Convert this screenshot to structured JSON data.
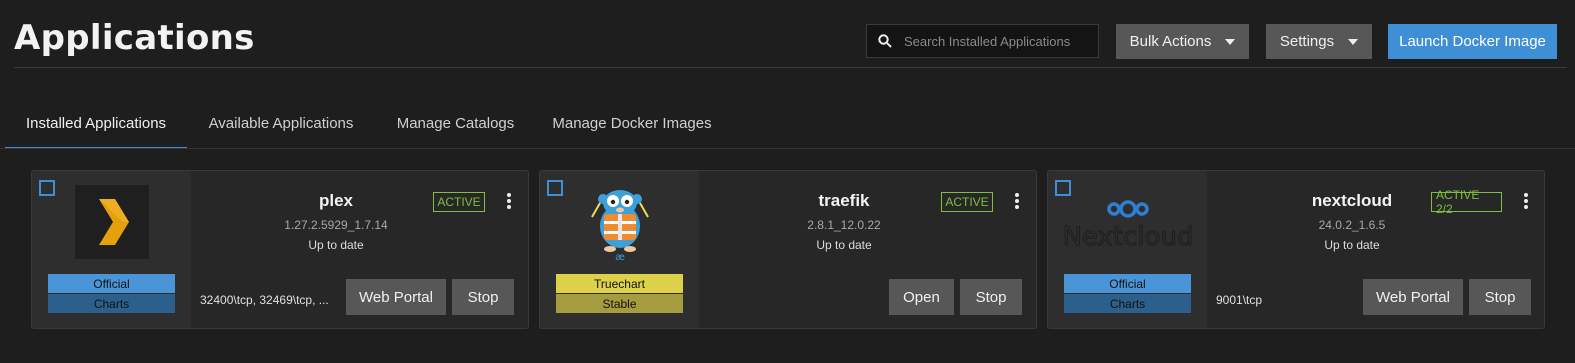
{
  "header": {
    "title": "Applications",
    "search_placeholder": "Search Installed Applications",
    "bulk_actions": "Bulk Actions",
    "settings": "Settings",
    "launch": "Launch Docker Image"
  },
  "tabs": [
    {
      "label": "Installed Applications",
      "active": true
    },
    {
      "label": "Available Applications",
      "active": false
    },
    {
      "label": "Manage Catalogs",
      "active": false
    },
    {
      "label": "Manage Docker Images",
      "active": false
    }
  ],
  "apps": [
    {
      "name": "plex",
      "version": "1.27.2.5929_1.7.14",
      "update_status": "Up to date",
      "status": "ACTIVE",
      "badge_top": "Official",
      "badge_bottom": "Charts",
      "ports": "32400\\tcp, 32469\\tcp, ...",
      "action1": "Web Portal",
      "action2": "Stop",
      "logo_icon": "plex-chevron-icon"
    },
    {
      "name": "traefik",
      "version": "2.8.1_12.0.22",
      "update_status": "Up to date",
      "status": "ACTIVE",
      "badge_top": "Truechart",
      "badge_bottom": "Stable",
      "ports": "",
      "action1": "Open",
      "action2": "Stop",
      "logo_icon": "traefik-gopher-icon"
    },
    {
      "name": "nextcloud",
      "version": "24.0.2_1.6.5",
      "update_status": "Up to date",
      "status": "ACTIVE 2/2",
      "badge_top": "Official",
      "badge_bottom": "Charts",
      "ports": "9001\\tcp",
      "action1": "Web Portal",
      "action2": "Stop",
      "logo_icon": "nextcloud-logo-icon",
      "logo_text": "Nextcloud"
    }
  ],
  "colors": {
    "accent": "#3f8fd6",
    "active_status": "#7fbf3f",
    "background": "#1e1e1e"
  }
}
